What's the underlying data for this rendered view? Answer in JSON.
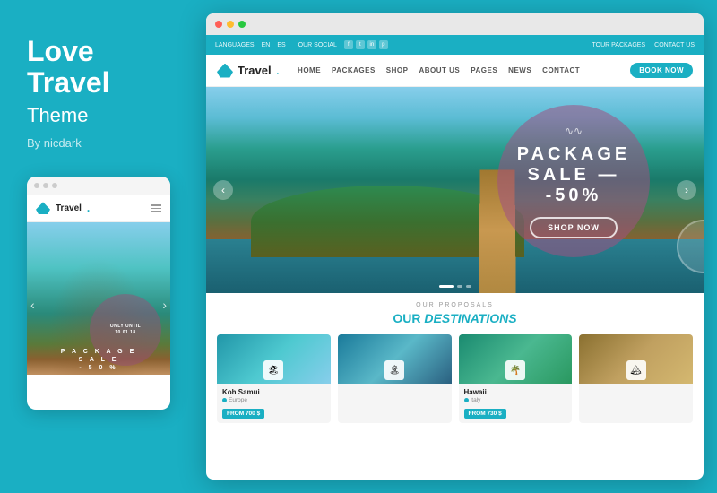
{
  "left": {
    "title_line1": "Love",
    "title_line2": "Travel",
    "subtitle": "Theme",
    "by": "By nicdark"
  },
  "mobile": {
    "logo_text": "Travel",
    "logo_dot": ".",
    "circle_text": "ONLY UNTIL\n10.01.18",
    "sale_lines": [
      "P A C K A G E",
      "S A L E",
      "- 5 0 %"
    ],
    "arrow_left": "‹",
    "arrow_right": "›"
  },
  "desktop": {
    "topbar": {
      "languages_label": "LANGUAGES",
      "lang_en": "EN",
      "lang_es": "ES",
      "social_label": "OUR SOCIAL",
      "tour_packages": "TOUR PACKAGES",
      "contact_us": "CONTACT US"
    },
    "nav": {
      "logo_text": "Travel",
      "logo_dot": ".",
      "links": [
        "HOME",
        "PACKAGES",
        "SHOP",
        "ABOUT US",
        "PAGES",
        "NEWS",
        "CONTACT"
      ],
      "book_btn": "BOOK NOW"
    },
    "hero": {
      "tilde": "∿∿",
      "sale_line1": "PACKAGE",
      "sale_line2": "SALE —",
      "sale_line3": "-50%",
      "shop_now": "SHOP NOW",
      "arrow_left": "‹",
      "arrow_right": "›"
    },
    "proposals": {
      "label": "OUR PROPOSALS",
      "title_plain": "OUR ",
      "title_emphasis": "DESTINATIONS"
    },
    "destinations": [
      {
        "name": "Koh Samui",
        "location": "Europe",
        "price": "FROM 700 $",
        "icon": "🏖"
      },
      {
        "name": "",
        "location": "",
        "price": "",
        "icon": "🏝"
      },
      {
        "name": "Hawaii",
        "location": "Italy",
        "price": "FROM 730 $",
        "icon": "🌴"
      },
      {
        "name": "",
        "location": "",
        "price": "",
        "icon": "🏔"
      }
    ]
  }
}
